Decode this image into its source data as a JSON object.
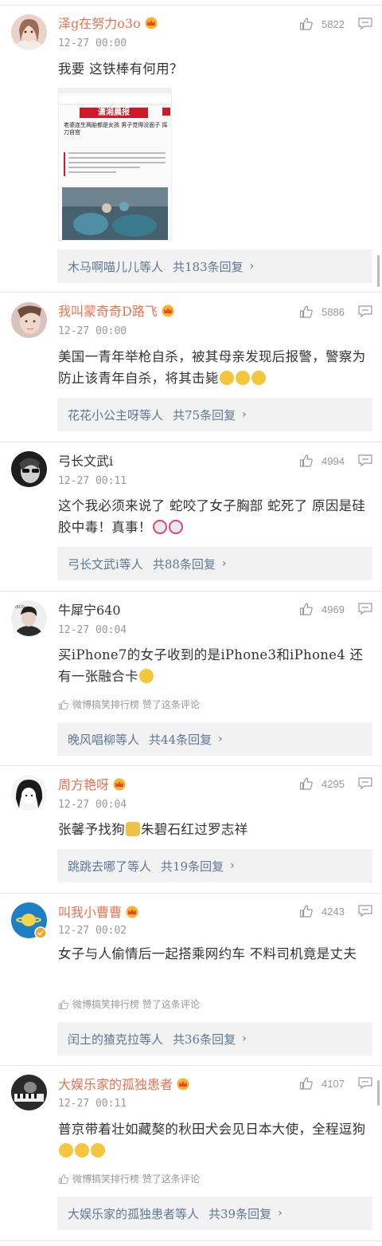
{
  "comments": [
    {
      "user": "泽g在努力o3o",
      "time": "12-27 00:00",
      "likes": "5822",
      "text": "我要 这铁棒有何用？",
      "reply_users": "木马啊喵儿儿等人",
      "reply_count": "共183条回复",
      "image": {
        "masthead": "潇湘晨报",
        "headline": "老婆连生两胎都是女孩 男子觉得没面子 挥刀自宫"
      }
    },
    {
      "user": "我叫蒙奇奇D路飞",
      "time": "12-27 00:00",
      "likes": "5886",
      "text": "美国一青年举枪自杀，被其母亲发现后报警，警察为防止该青年自杀，将其击毙",
      "reply_users": "花花小公主呀等人",
      "reply_count": "共75条回复"
    },
    {
      "user": "弓长文武i",
      "time": "12-27 00:11",
      "likes": "4994",
      "text": "这个我必须来说了 蛇咬了女子胸部 蛇死了 原因是硅胶中毒！真事！",
      "reply_users": "弓长文武i等人",
      "reply_count": "共88条回复"
    },
    {
      "user": "牛犀宁640",
      "time": "12-27 00:04",
      "likes": "4969",
      "text": "买iPhone7的女子收到的是iPhone3和iPhone4 还有一张融合卡",
      "badge": "微博搞笑排行榜 赞了这条评论",
      "reply_users": "晚风唱柳等人",
      "reply_count": "共44条回复"
    },
    {
      "user": "周方艳呀",
      "time": "12-27 00:04",
      "likes": "4295",
      "text_a": "张馨予找狗",
      "text_b": "朱碧石红过罗志祥",
      "reply_users": "跳跳去哪了等人",
      "reply_count": "共19条回复"
    },
    {
      "user": "叫我小曹曹",
      "time": "12-27 00:02",
      "likes": "4243",
      "text": "女子与人偷情后一起搭乘网约车 不料司机竟是丈夫",
      "badge": "微博搞笑排行榜 赞了这条评论",
      "reply_users": "闰土的猹克拉等人",
      "reply_count": "共36条回复"
    },
    {
      "user": "大娱乐家的孤独患者",
      "time": "12-27 00:11",
      "likes": "4107",
      "text": "普京带着壮如藏獒的秋田犬会见日本大使，全程逗狗",
      "badge": "微博搞笑排行榜 赞了这条评论",
      "reply_users": "大娱乐家的孤独患者等人",
      "reply_count": "共39条回复"
    }
  ],
  "colors": {
    "vip_name": "#eb7350",
    "link": "#5d7895",
    "meta": "#999999",
    "reply_bg": "#f2f2f2"
  }
}
